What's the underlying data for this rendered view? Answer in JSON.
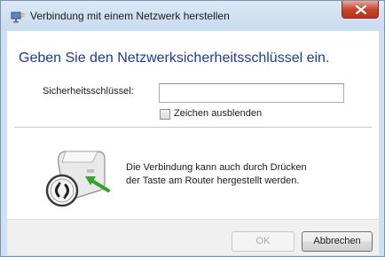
{
  "window": {
    "title": "Verbindung mit einem Netzwerk herstellen",
    "close_label": "X"
  },
  "main": {
    "heading": "Geben Sie den Netzwerksicherheitsschlüssel ein.",
    "key_label": "Sicherheitsschlüssel:",
    "key_value": "",
    "hide_chars_label": "Zeichen ausblenden",
    "hide_chars_checked": false,
    "router_text_line1": "Die Verbindung kann auch durch Drücken",
    "router_text_line2": "der Taste am Router hergestellt werden."
  },
  "buttons": {
    "ok": "OK",
    "cancel": "Abbrechen"
  },
  "icons": {
    "title": "network-connection-icon",
    "router": "router-wps-button-icon",
    "close": "close-icon"
  },
  "colors": {
    "heading": "#1e3a9a",
    "close_button": "#c8452d",
    "window_frame": "#cfe0f2"
  }
}
